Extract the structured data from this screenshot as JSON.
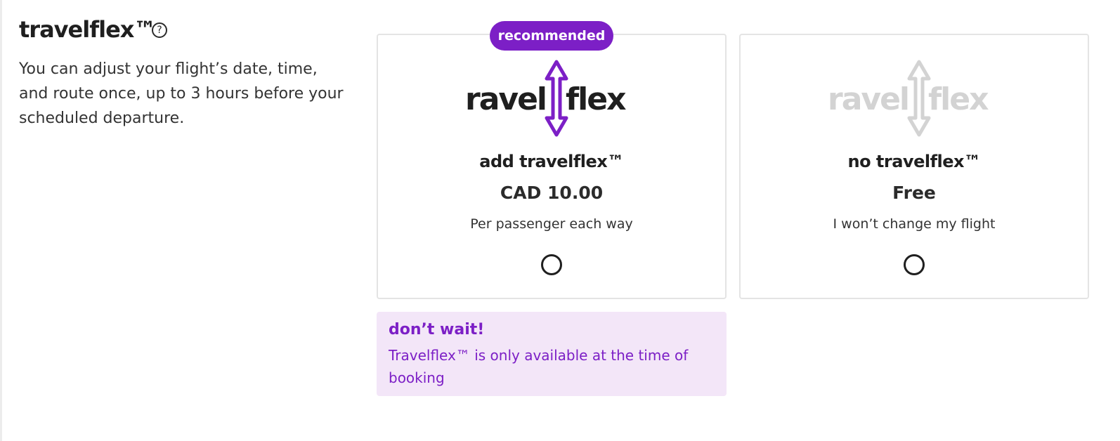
{
  "section": {
    "title": "travelflex™",
    "help_icon": "question-circle-icon",
    "description": "You can adjust your flight’s date, time, and route once, up to 3 hours before your scheduled departure."
  },
  "options": [
    {
      "badge": "recommended",
      "logo_text_left": "travel",
      "logo_text_right": "flex",
      "logo_color": "#7c1fc6",
      "title": "add travelflex™",
      "price": "CAD 10.00",
      "subtitle": "Per passenger each way",
      "selected": false
    },
    {
      "logo_text_left": "travel",
      "logo_text_right": "flex",
      "logo_color": "#d3d3d3",
      "title": "no travelflex™",
      "price": "Free",
      "subtitle": "I won’t change my flight",
      "selected": false
    }
  ],
  "notice": {
    "title": "don’t wait!",
    "body": "Travelflex™ is only available at the time of booking"
  },
  "colors": {
    "accent": "#7c1fc6",
    "notice_bg": "#f3e6f8",
    "card_border": "#e4e4e4",
    "disabled_logo": "#d3d3d3"
  }
}
